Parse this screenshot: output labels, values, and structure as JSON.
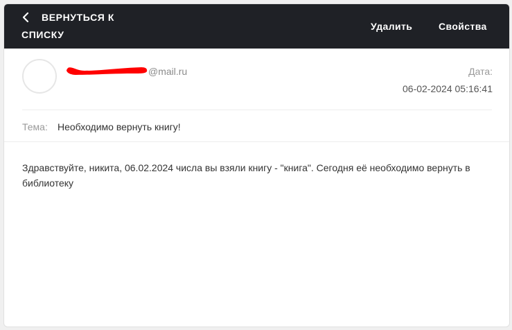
{
  "header": {
    "back_line1": "ВЕРНУТЬСЯ  К",
    "back_line2": "СПИСКУ",
    "delete_label": "Удалить",
    "properties_label": "Свойства"
  },
  "message": {
    "sender_domain": "@mail.ru",
    "date_label": "Дата:",
    "date_value": "06-02-2024 05:16:41",
    "subject_label": "Тема:",
    "subject_value": "Необходимо вернуть книгу!",
    "body": "Здравствуйте, никита, 06.02.2024 числа вы взяли книгу - \"книга\". Сегодня её необходимо вернуть в библиотеку"
  },
  "colors": {
    "header_bg": "#1f2126",
    "redaction": "#ff0000"
  },
  "icons": {
    "back": "chevron-left-icon"
  }
}
